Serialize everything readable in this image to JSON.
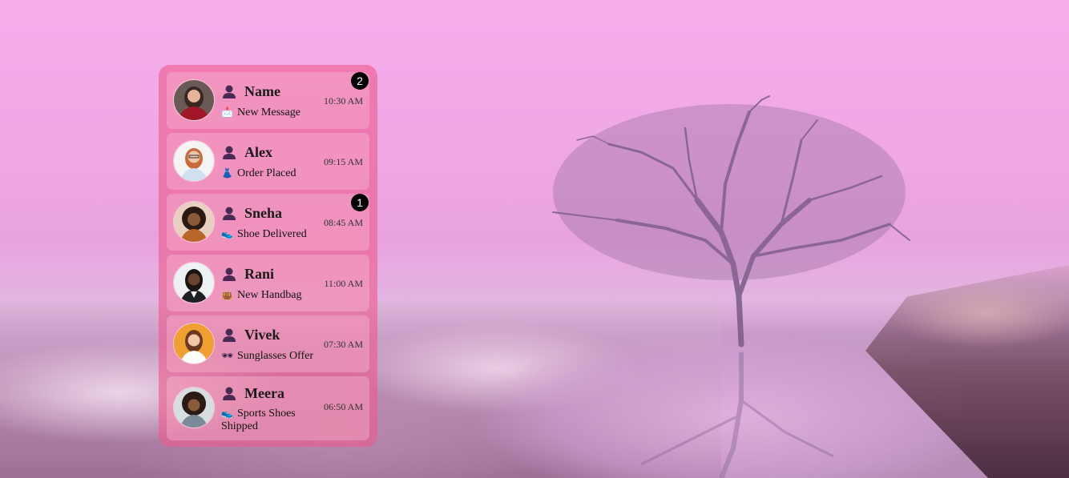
{
  "notifications": [
    {
      "name": "Name",
      "message": "New Message",
      "emoji": "📩",
      "time": "10:30 AM",
      "badge": "2",
      "avatar": "avatar-woman-red-dress"
    },
    {
      "name": "Alex",
      "message": "Order Placed",
      "emoji": "👗",
      "time": "09:15 AM",
      "badge": "",
      "avatar": "avatar-woman-glasses"
    },
    {
      "name": "Sneha",
      "message": "Shoe Delivered",
      "emoji": "👟",
      "time": "08:45 AM",
      "badge": "1",
      "avatar": "avatar-woman-curly-hair"
    },
    {
      "name": "Rani",
      "message": "New Handbag",
      "emoji": "👜",
      "time": "11:00 AM",
      "badge": "",
      "avatar": "avatar-woman-black-hair"
    },
    {
      "name": "Vivek",
      "message": "Sunglasses Offer",
      "emoji": "🕶",
      "time": "07:30 AM",
      "badge": "",
      "avatar": "avatar-woman-orange-bg"
    },
    {
      "name": "Meera",
      "message": "Sports Shoes Shipped",
      "emoji": "👟",
      "time": "06:50 AM",
      "badge": "",
      "avatar": "avatar-woman-afro"
    }
  ],
  "colors": {
    "panel": "#ec5a8c",
    "badge": "#000000",
    "user_icon": "#4a2a55"
  }
}
